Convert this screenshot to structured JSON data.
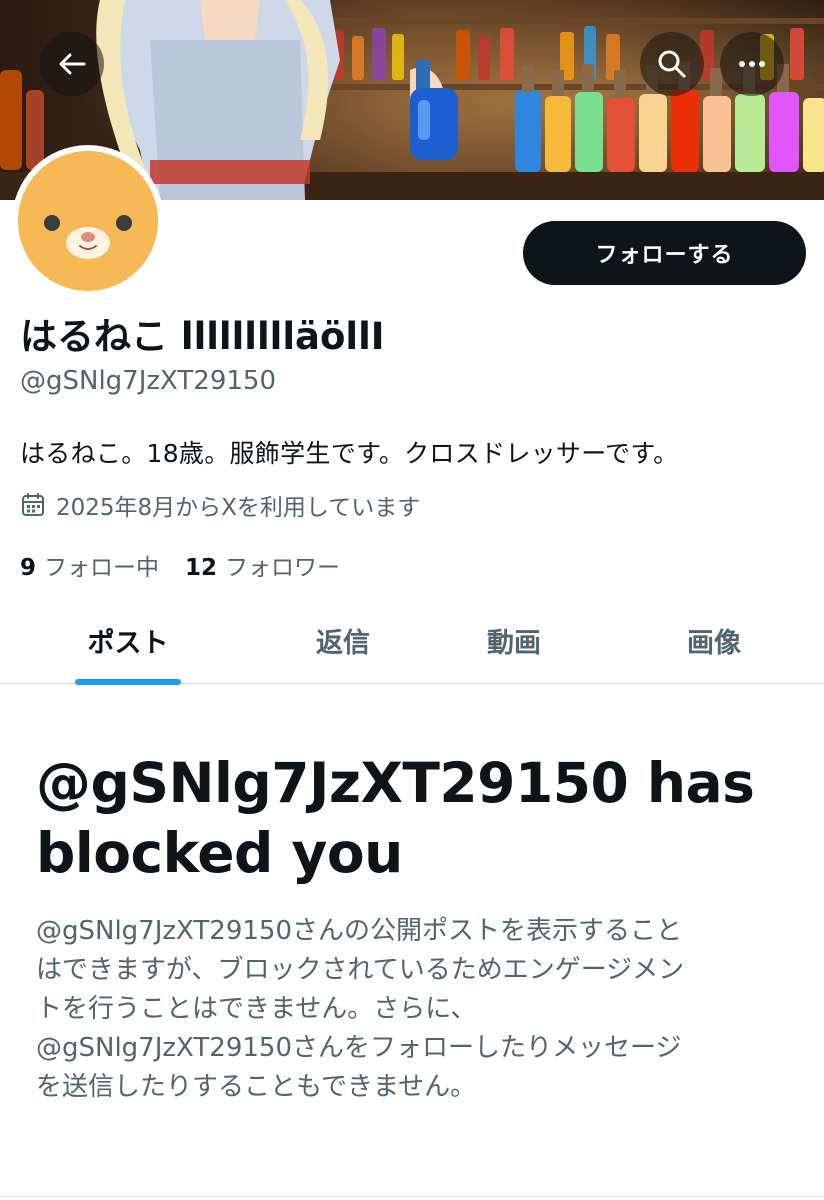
{
  "header": {
    "back_icon": "arrow-left-icon",
    "search_icon": "search-icon",
    "more_icon": "more-horizontal-icon"
  },
  "profile": {
    "display_name": "はるねこ llllllllläöllI",
    "handle": "@gSNlg7JzXT29150",
    "bio": "はるねこ。18歳。服飾学生です。クロスドレッサーです。",
    "joined": "2025年8月からXを利用しています",
    "following_count": "9",
    "following_label": "フォロー中",
    "followers_count": "12",
    "followers_label": "フォロワー",
    "follow_button": "フォローする"
  },
  "tabs": [
    {
      "label": "ポスト",
      "active": true
    },
    {
      "label": "返信",
      "active": false
    },
    {
      "label": "動画",
      "active": false
    },
    {
      "label": "画像",
      "active": false
    }
  ],
  "blocked": {
    "title": "@gSNlg7JzXT29150 has blocked you",
    "description_lines": [
      "@gSNlg7JzXT29150さんの公開ポストを表示すること",
      "はできますが、ブロックされているためエンゲージメン",
      "トを行うことはできません。さらに、",
      "@gSNlg7JzXT29150さんをフォローしたりメッセージ",
      "を送信したりすることもできません。"
    ]
  },
  "colors": {
    "text_primary": "#0f1419",
    "text_secondary": "#536471",
    "accent": "#1d9bf0",
    "follow_button_bg": "#0f1419"
  }
}
